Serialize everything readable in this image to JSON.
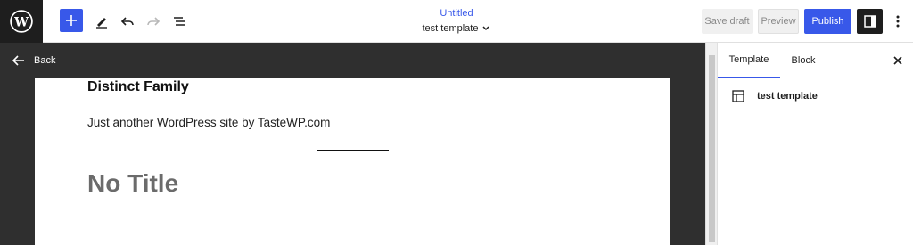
{
  "header": {
    "document_title": "Untitled",
    "template_name": "test template",
    "save_draft_label": "Save draft",
    "preview_label": "Preview",
    "publish_label": "Publish"
  },
  "canvas": {
    "back_label": "Back",
    "site_title": "Distinct Family",
    "tagline": "Just another WordPress site by TasteWP.com",
    "post_title": "No Title"
  },
  "sidebar": {
    "tabs": [
      {
        "label": "Template",
        "active": true
      },
      {
        "label": "Block",
        "active": false
      }
    ],
    "template_item_label": "test template"
  },
  "colors": {
    "accent": "#3858e9",
    "dark": "#1e1e1e",
    "canvas_bg": "#2f2f2f"
  },
  "icons": [
    "wordpress-logo",
    "plus-icon",
    "pencil-icon",
    "undo-icon",
    "redo-icon",
    "list-view-icon",
    "chevron-down-icon",
    "sidebar-toggle-icon",
    "more-vertical-icon",
    "arrow-left-icon",
    "close-icon",
    "layout-icon"
  ]
}
